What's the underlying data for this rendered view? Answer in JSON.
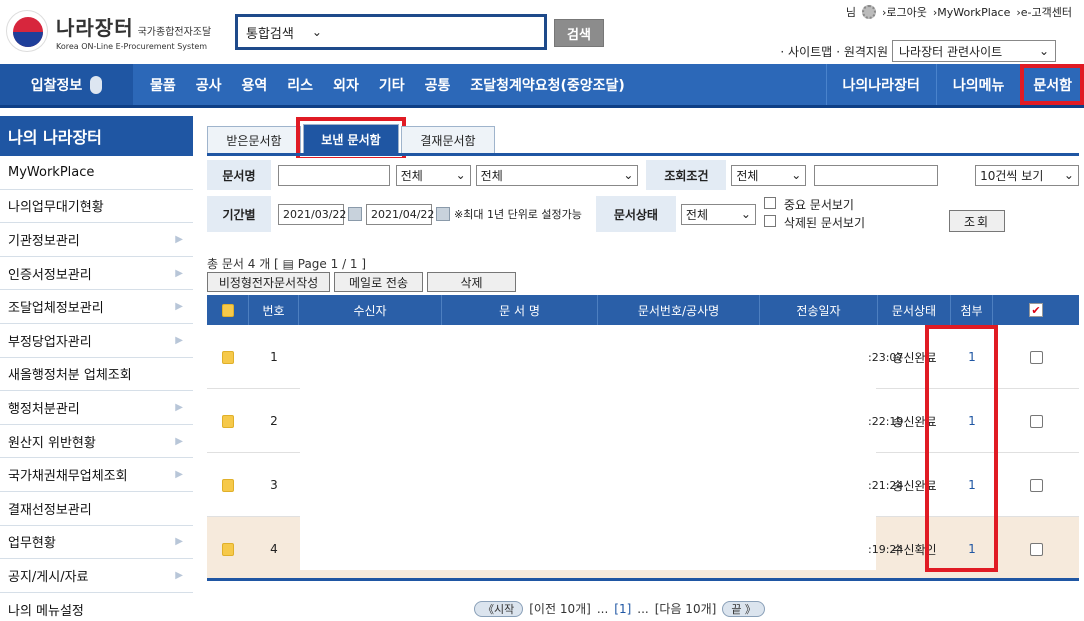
{
  "logo": {
    "title": "나라장터",
    "subtitle": "국가종합전자조달",
    "english": "Korea ON-Line E-Procurement System"
  },
  "search": {
    "scope": "통합검색",
    "button": "검색"
  },
  "top_links": {
    "user_suffix": "님",
    "logout": "›로그아웃",
    "workplace": "›MyWorkPlace",
    "customer_center": "›e-고객센터"
  },
  "site_links": {
    "sitemap": "· 사이트맵",
    "remote_support": "· 원격지원",
    "related_sites": "나라장터 관련사이트"
  },
  "nav": {
    "bid_info": "입찰정보",
    "items": [
      "물품",
      "공사",
      "용역",
      "리스",
      "외자",
      "기타",
      "공통",
      "조달청계약요청(중앙조달)"
    ],
    "my_narajangteo": "나의나라장터",
    "my_menu": "나의메뉴",
    "mailbox": "문서함"
  },
  "sidebar": {
    "title": "나의 나라장터",
    "items": [
      {
        "label": "MyWorkPlace",
        "arrow": false
      },
      {
        "label": "나의업무대기현황",
        "arrow": false
      },
      {
        "label": "기관정보관리",
        "arrow": true
      },
      {
        "label": "인증서정보관리",
        "arrow": true
      },
      {
        "label": "조달업체정보관리",
        "arrow": true
      },
      {
        "label": "부정당업자관리",
        "arrow": true
      },
      {
        "label": "새올행정처분 업체조회",
        "arrow": false
      },
      {
        "label": "행정처분관리",
        "arrow": true
      },
      {
        "label": "원산지 위반현황",
        "arrow": true
      },
      {
        "label": "국가채권채무업체조회",
        "arrow": true
      },
      {
        "label": "결재선정보관리",
        "arrow": false
      },
      {
        "label": "업무현황",
        "arrow": true
      },
      {
        "label": "공지/게시/자료",
        "arrow": true
      },
      {
        "label": "나의 메뉴설정",
        "arrow": false
      }
    ]
  },
  "tabs": {
    "received": "받은문서함",
    "sent": "보낸 문서함",
    "approval": "결재문서함"
  },
  "filter": {
    "doc_name_label": "문서명",
    "doc_name_value": "",
    "select1": "전체",
    "select2": "전체",
    "query_cond_label": "조회조건",
    "query_cond_select": "전체",
    "query_cond_value": "",
    "page_size": "10건씩 보기",
    "period_label": "기간별",
    "date_from": "2021/03/22",
    "date_to": "2021/04/22",
    "period_note": "※최대 1년 단위로 설정가능",
    "status_label": "문서상태",
    "status_select": "전체",
    "important_only": "중요 문서보기",
    "deleted_only": "삭제된 문서보기",
    "query_button": "조회"
  },
  "summary": {
    "total": "총 문서 4 개 [",
    "page": "Page 1 / 1 ]"
  },
  "actions": {
    "write_atypical": "비정형전자문서작성",
    "send_mail": "메일로 전송",
    "delete": "삭제"
  },
  "table": {
    "headers": [
      "번호",
      "수신자",
      "문 서 명",
      "문서번호/공사명",
      "전송일자",
      "문서상태",
      "첨부"
    ],
    "rows": [
      {
        "no": "1",
        "time": ":23:07",
        "status": "송신완료",
        "attach": "1",
        "highlight": false
      },
      {
        "no": "2",
        "time": ":22:19",
        "status": "송신완료",
        "attach": "1",
        "highlight": false
      },
      {
        "no": "3",
        "time": ":21:24",
        "status": "송신완료",
        "attach": "1",
        "highlight": false
      },
      {
        "no": "4",
        "time": ":19:24",
        "status": "수신확인",
        "attach": "1",
        "highlight": true
      }
    ]
  },
  "pager": {
    "first": "《시작",
    "prev": "[이전 10개]",
    "dots1": "...",
    "current": "[1]",
    "dots2": "...",
    "next": "[다음 10개]",
    "last": "끝 》"
  }
}
